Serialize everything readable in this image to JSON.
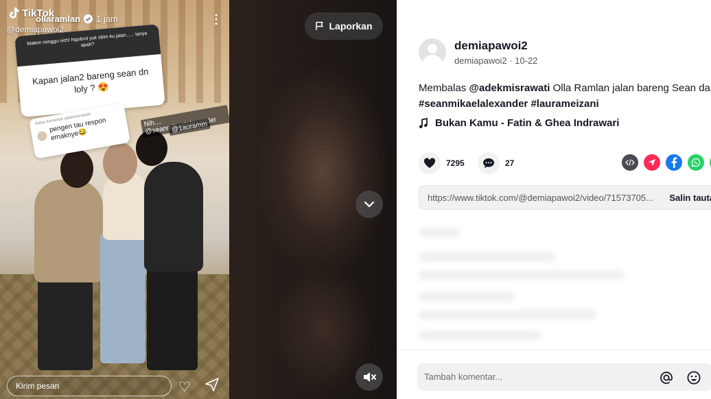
{
  "video": {
    "story": {
      "app_logo": "TikTok",
      "handle": "@demiapawoi2",
      "story_user": "ollaramlan",
      "story_time": "1 jam",
      "question_prompt": "Malem minggu nich! Ngobrol yuk sblm ku jalan...... tanya apah?",
      "question_answer": "Kapan jalan2 bareng sean dn loly ? 😍",
      "reply_header": "Balas komentar adekmisrawati",
      "reply_text": "pengen tau respon emaknye😂",
      "mention_1": "Nih.... @seanmikaelalexander",
      "mention_2": "@1auramm",
      "send_placeholder": "Kirim pesan"
    },
    "report_label": "Laporkan",
    "icons": [
      "flag-icon",
      "chevron-down-icon",
      "mute-icon"
    ]
  },
  "panel": {
    "username": "demiapawoi2",
    "subline": "demiapawoi2 · 10-22",
    "caption_prefix": "Membalas",
    "caption_mention": "@adekmisrawati",
    "caption_text": "Olla Ramlan jalan bareng Sean dan Lo",
    "caption_tags": "#seanmikaelalexander #laurameizani",
    "music": "Bukan Kamu - Fatin & Ghea Indrawari",
    "likes": "7295",
    "comments": "27",
    "share_colors": [
      "#4a4a50",
      "#fe2c55",
      "#1877f2",
      "#25d366"
    ],
    "link_url": "https://www.tiktok.com/@demiapawoi2/video/71573705...",
    "copy_label": "Salin tautan",
    "comment_placeholder": "Tambah komentar..."
  }
}
